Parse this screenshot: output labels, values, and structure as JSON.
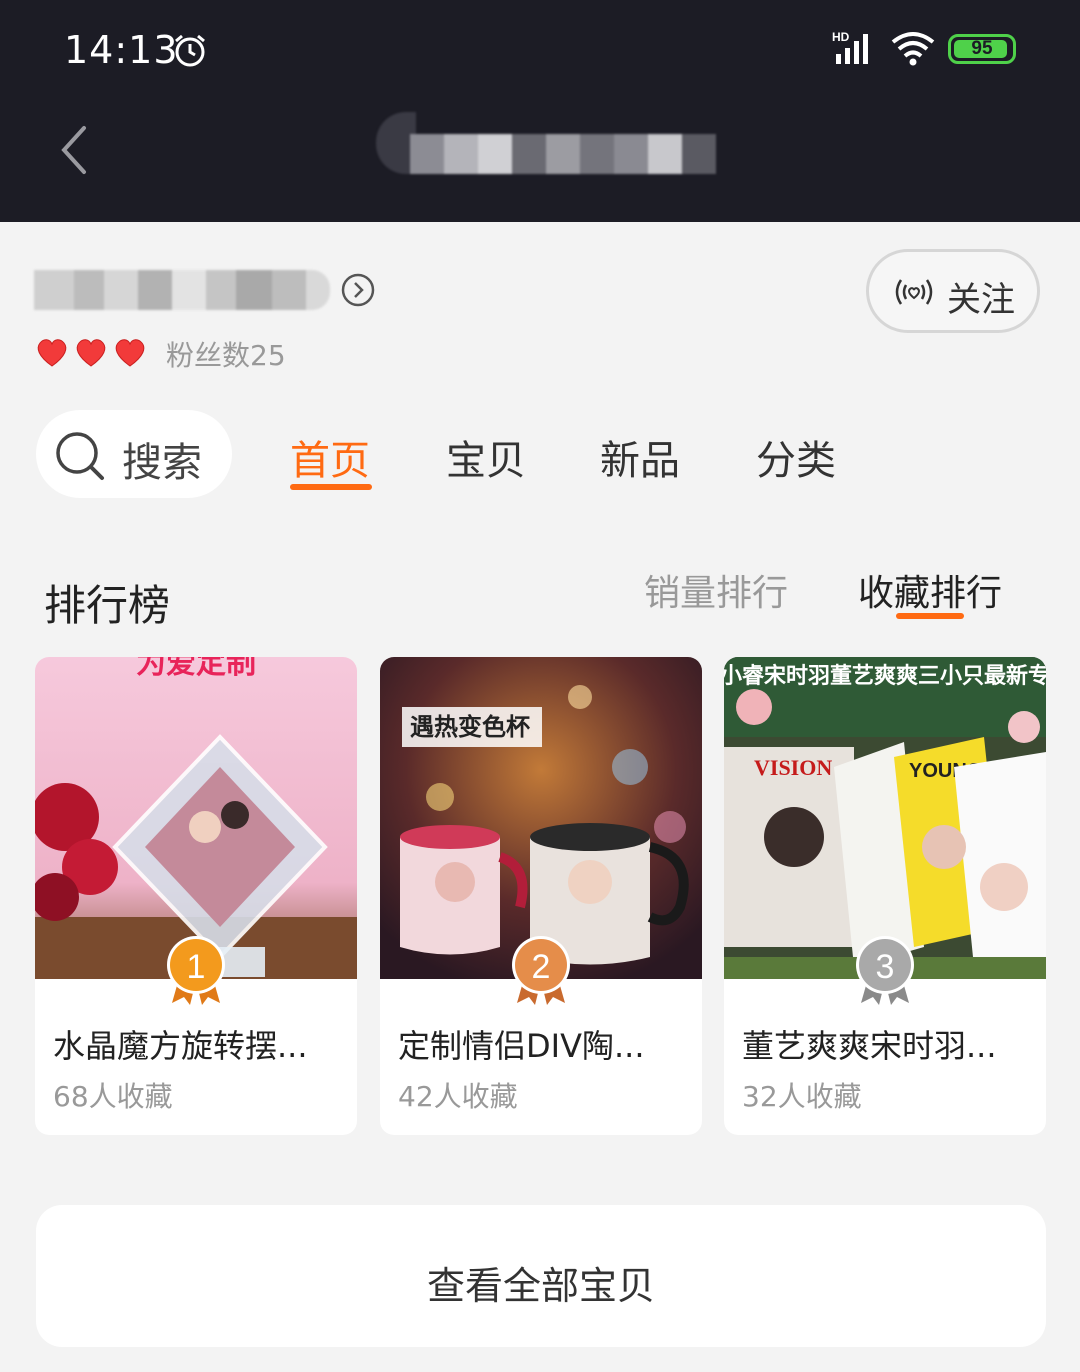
{
  "status_bar": {
    "time": "14:13",
    "signal_label": "HD",
    "battery": "95",
    "battery_level": 0.95,
    "battery_color": "#4fd14a"
  },
  "nav": {
    "back_icon": "chevron-left-icon"
  },
  "store": {
    "fans": "粉丝数25",
    "hearts": 3,
    "follow_label": "关注"
  },
  "tabs": {
    "search_label": "搜索",
    "items": [
      "首页",
      "宝贝",
      "新品",
      "分类"
    ],
    "active": "首页"
  },
  "ranking": {
    "title": "排行榜",
    "sort_sales": "销量排行",
    "sort_favorites": "收藏排行",
    "active_sort": "收藏排行"
  },
  "products": [
    {
      "rank": "1",
      "title": "水晶魔方旋转摆...",
      "favorites": "68人收藏",
      "image_text": "为爱定制",
      "medal_color": "#f39a1d"
    },
    {
      "rank": "2",
      "title": "定制情侣DIV陶...",
      "favorites": "42人收藏",
      "image_text": "遇热变色杯",
      "medal_color": "#e58d4a"
    },
    {
      "rank": "3",
      "title": "董艺爽爽宋时羽...",
      "favorites": "32人收藏",
      "image_text": "宋小睿宋时羽董艺爽爽三小只最新专辑",
      "medal_color": "#a9a9a9"
    }
  ],
  "view_all_label": "查看全部宝贝",
  "colors": {
    "accent": "#ff6a12",
    "header_bg": "#1c1c25",
    "page_bg": "#f3f3f3"
  }
}
